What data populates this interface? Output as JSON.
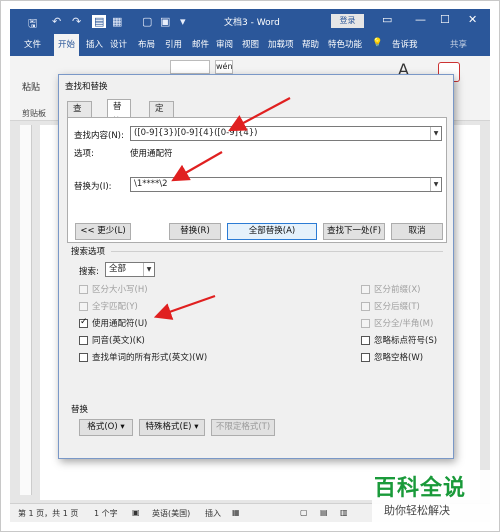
{
  "window": {
    "title": "文档3 - Word",
    "login": "登录",
    "min": "—",
    "restore": "☐",
    "close": "✕"
  },
  "ribbon": {
    "tabs": [
      "文件",
      "开始",
      "插入",
      "设计",
      "布局",
      "引用",
      "邮件",
      "审阅",
      "视图",
      "加载项",
      "帮助",
      "特色功能"
    ],
    "active_tab": "开始",
    "tell_me": "告诉我",
    "share": "共享",
    "paste": "粘贴",
    "clipboard": "剪贴板",
    "wen": "wén"
  },
  "dialog": {
    "title": "查找和替换",
    "tabs": [
      "查找(D)",
      "替换(P)",
      "定位(G)"
    ],
    "find_label": "查找内容(N):",
    "find_value": "([0-9]{3})[0-9]{4}([0-9]{4})",
    "options_label": "选项:",
    "options_value": "使用通配符",
    "replace_label": "替换为(I):",
    "replace_value": "\\1****\\2",
    "buttons": {
      "less": "<< 更少(L)",
      "replace": "替换(R)",
      "replace_all": "全部替换(A)",
      "find_next": "查找下一处(F)",
      "cancel": "取消"
    },
    "search_options_title": "搜索选项",
    "search_label": "搜索:",
    "search_value": "全部",
    "left_options": [
      {
        "label": "区分大小写(H)",
        "checked": false,
        "enabled": false
      },
      {
        "label": "全字匹配(Y)",
        "checked": false,
        "enabled": false
      },
      {
        "label": "使用通配符(U)",
        "checked": true,
        "enabled": true
      },
      {
        "label": "同音(英文)(K)",
        "checked": false,
        "enabled": true
      },
      {
        "label": "查找单词的所有形式(英文)(W)",
        "checked": false,
        "enabled": true
      }
    ],
    "right_options": [
      {
        "label": "区分前缀(X)",
        "checked": false,
        "enabled": false
      },
      {
        "label": "区分后缀(T)",
        "checked": false,
        "enabled": false
      },
      {
        "label": "区分全/半角(M)",
        "checked": false,
        "enabled": false
      },
      {
        "label": "忽略标点符号(S)",
        "checked": false,
        "enabled": true
      },
      {
        "label": "忽略空格(W)",
        "checked": false,
        "enabled": true
      }
    ],
    "replace_section_title": "替换",
    "format_button": "格式(O) ▾",
    "special_button": "特殊格式(E) ▾",
    "no_format_button": "不限定格式(T)"
  },
  "statusbar": {
    "page": "第 1 页，共 1 页",
    "words": "1 个字",
    "lang": "英语(美国)",
    "insert": "插入"
  },
  "watermark": {
    "main": "百科全说",
    "sub": "助你轻松解决"
  },
  "colors": {
    "word_blue": "#2b579a",
    "arrow_red": "#e02020",
    "watermark_green": "#1a9a3a"
  }
}
